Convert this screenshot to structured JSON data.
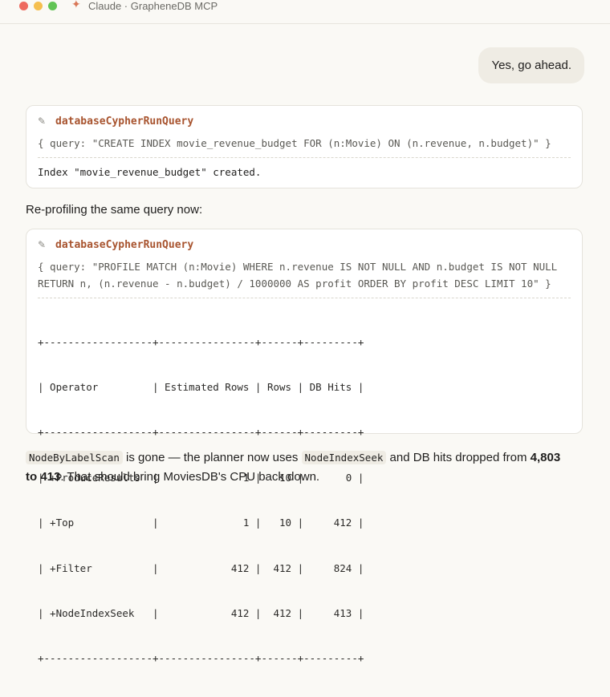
{
  "window": {
    "title": "Claude · GrapheneDB MCP"
  },
  "user_message": "Yes, go ahead.",
  "tool_call_1": {
    "name": "databaseCypherRunQuery",
    "query": "{ query: \"CREATE INDEX movie_revenue_budget FOR (n:Movie) ON (n.revenue, n.budget)\" }",
    "result": "Index \"movie_revenue_budget\" created."
  },
  "intro_text": "Re-profiling the same query now:",
  "tool_call_2": {
    "name": "databaseCypherRunQuery",
    "query_line1": "{ query: \"PROFILE MATCH (n:Movie) WHERE n.revenue IS NOT NULL AND n.budget IS NOT NULL",
    "query_line2": "RETURN n, (n.revenue - n.budget) / 1000000 AS profit ORDER BY profit DESC LIMIT 10\" }",
    "table": {
      "border": "+------------------+----------------+------+---------+",
      "header": "| Operator         | Estimated Rows | Rows | DB Hits |",
      "rows": [
        "| +ProduceResults  |              1 |   10 |       0 |",
        "| +Top             |              1 |   10 |     412 |",
        "| +Filter          |            412 |  412 |     824 |",
        "| +NodeIndexSeek   |            412 |  412 |     413 |"
      ]
    }
  },
  "summary": {
    "code1": "NodeByLabelScan",
    "text1": " is gone — the planner now uses ",
    "code2": "NodeIndexSeek",
    "text2": " and DB hits dropped from ",
    "bold1": "4,803",
    "bold_to": "to 413",
    "text3": ". That should bring MoviesDB's CPU back down."
  }
}
